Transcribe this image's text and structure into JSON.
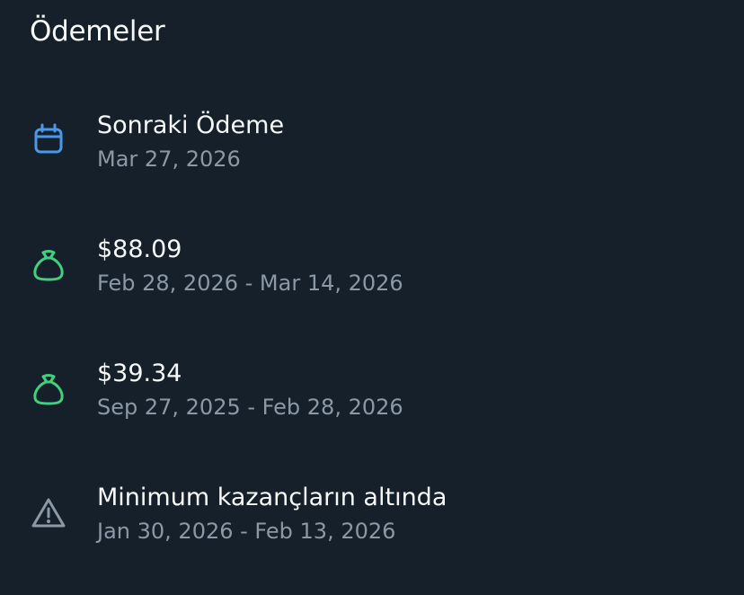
{
  "section": {
    "title": "Ödemeler"
  },
  "items": [
    {
      "icon": "calendar-icon",
      "icon_color": "#4a99e9",
      "title": "Sonraki Ödeme",
      "subtitle": "Mar 27, 2026"
    },
    {
      "icon": "money-bag-icon",
      "icon_color": "#3fd17f",
      "title": "$88.09",
      "subtitle": "Feb 28, 2026 - Mar 14, 2026"
    },
    {
      "icon": "money-bag-icon",
      "icon_color": "#3fd17f",
      "title": "$39.34",
      "subtitle": "Sep 27, 2025 - Feb 28, 2026"
    },
    {
      "icon": "warning-icon",
      "icon_color": "#8b98a5",
      "title": "Minimum kazançların altında",
      "subtitle": "Jan 30, 2026 - Feb 13, 2026"
    }
  ]
}
